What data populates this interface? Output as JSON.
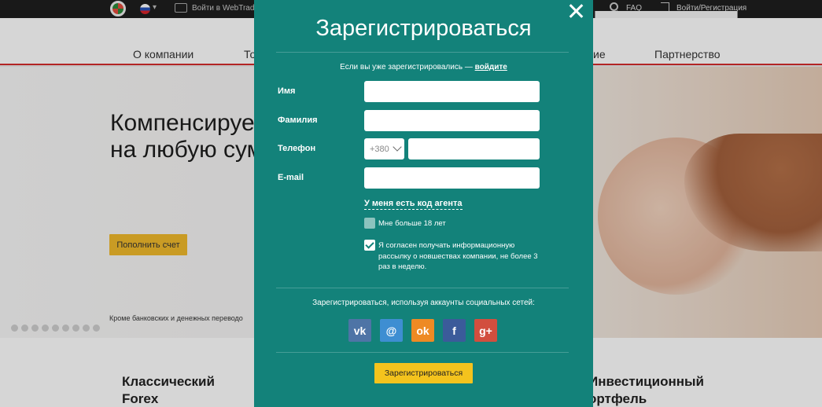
{
  "topbar": {
    "webtrader": "Войти в WebTrader",
    "faq": "FAQ",
    "login": "Войти/Регистрация"
  },
  "nav": {
    "items": [
      "О компании",
      "То",
      "ие",
      "Партнерство"
    ]
  },
  "hero": {
    "title": "Компенсируе\nна любую сум",
    "button": "Пополнить счет",
    "note": "Кроме банковских и денежных переводо"
  },
  "products": [
    "Классический\nForex",
    "Инвестиционный\nортфель"
  ],
  "modal": {
    "title": "Зарегистрироваться",
    "login_prompt": "Если вы уже зарегистрировались — ",
    "login_link": "войдите",
    "fields": {
      "first_name": {
        "label": "Имя",
        "value": ""
      },
      "last_name": {
        "label": "Фамилия",
        "value": ""
      },
      "phone": {
        "label": "Телефон",
        "code": "+380",
        "value": ""
      },
      "email": {
        "label": "E-mail",
        "value": ""
      }
    },
    "agent_link": "У меня есть код агента",
    "age_check": {
      "label": "Мне больше 18 лет",
      "checked": false
    },
    "news_check": {
      "label": "Я согласен получать информационную рассылку о новшествах компании, не более 3 раз в неделю.",
      "checked": true
    },
    "social_prompt": "Зарегистрироваться, используя аккаунты социальных сетей:",
    "social": [
      {
        "name": "vk",
        "glyph": "vk",
        "color": "#4e74a6"
      },
      {
        "name": "mail",
        "glyph": "@",
        "color": "#3e8ed2"
      },
      {
        "name": "odnoklassniki",
        "glyph": "ok",
        "color": "#ee8a24"
      },
      {
        "name": "facebook",
        "glyph": "f",
        "color": "#3b5b9a"
      },
      {
        "name": "google-plus",
        "glyph": "g+",
        "color": "#d24e3e"
      }
    ],
    "submit": "Зарегистрироваться"
  }
}
